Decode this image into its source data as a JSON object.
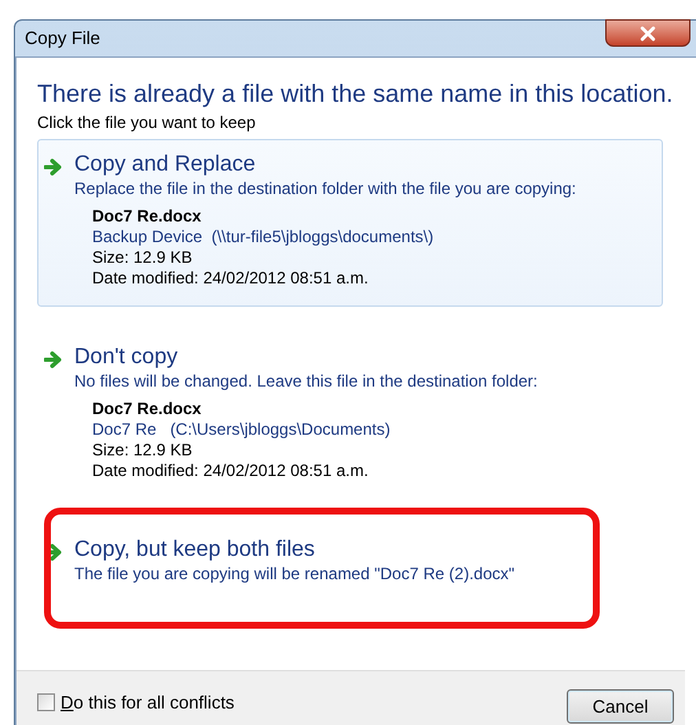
{
  "window": {
    "title": "Copy File"
  },
  "heading": "There is already a file with the same name in this location.",
  "instruction": "Click the file you want to keep",
  "options": [
    {
      "title": "Copy and Replace",
      "description": "Replace the file in the destination folder with the file you are copying:",
      "selected": true,
      "annotated": false,
      "file": {
        "name": "Doc7 Re.docx",
        "location": "Backup Device  (\\\\tur-file5\\jbloggs\\documents\\)",
        "size": "Size: 12.9 KB",
        "modified": "Date modified: 24/02/2012 08:51 a.m."
      }
    },
    {
      "title": "Don't copy",
      "description": "No files will be changed. Leave this file in the destination folder:",
      "selected": false,
      "annotated": false,
      "file": {
        "name": "Doc7 Re.docx",
        "location": "Doc7 Re   (C:\\Users\\jbloggs\\Documents)",
        "size": "Size: 12.9 KB",
        "modified": "Date modified: 24/02/2012 08:51 a.m."
      }
    },
    {
      "title": "Copy, but keep both files",
      "description": "The file you are copying will be renamed \"Doc7 Re (2).docx\"",
      "selected": false,
      "annotated": true
    }
  ],
  "apply_all": {
    "label": "Do this for all conflicts",
    "checked": false
  },
  "buttons": [
    "Cancel"
  ]
}
